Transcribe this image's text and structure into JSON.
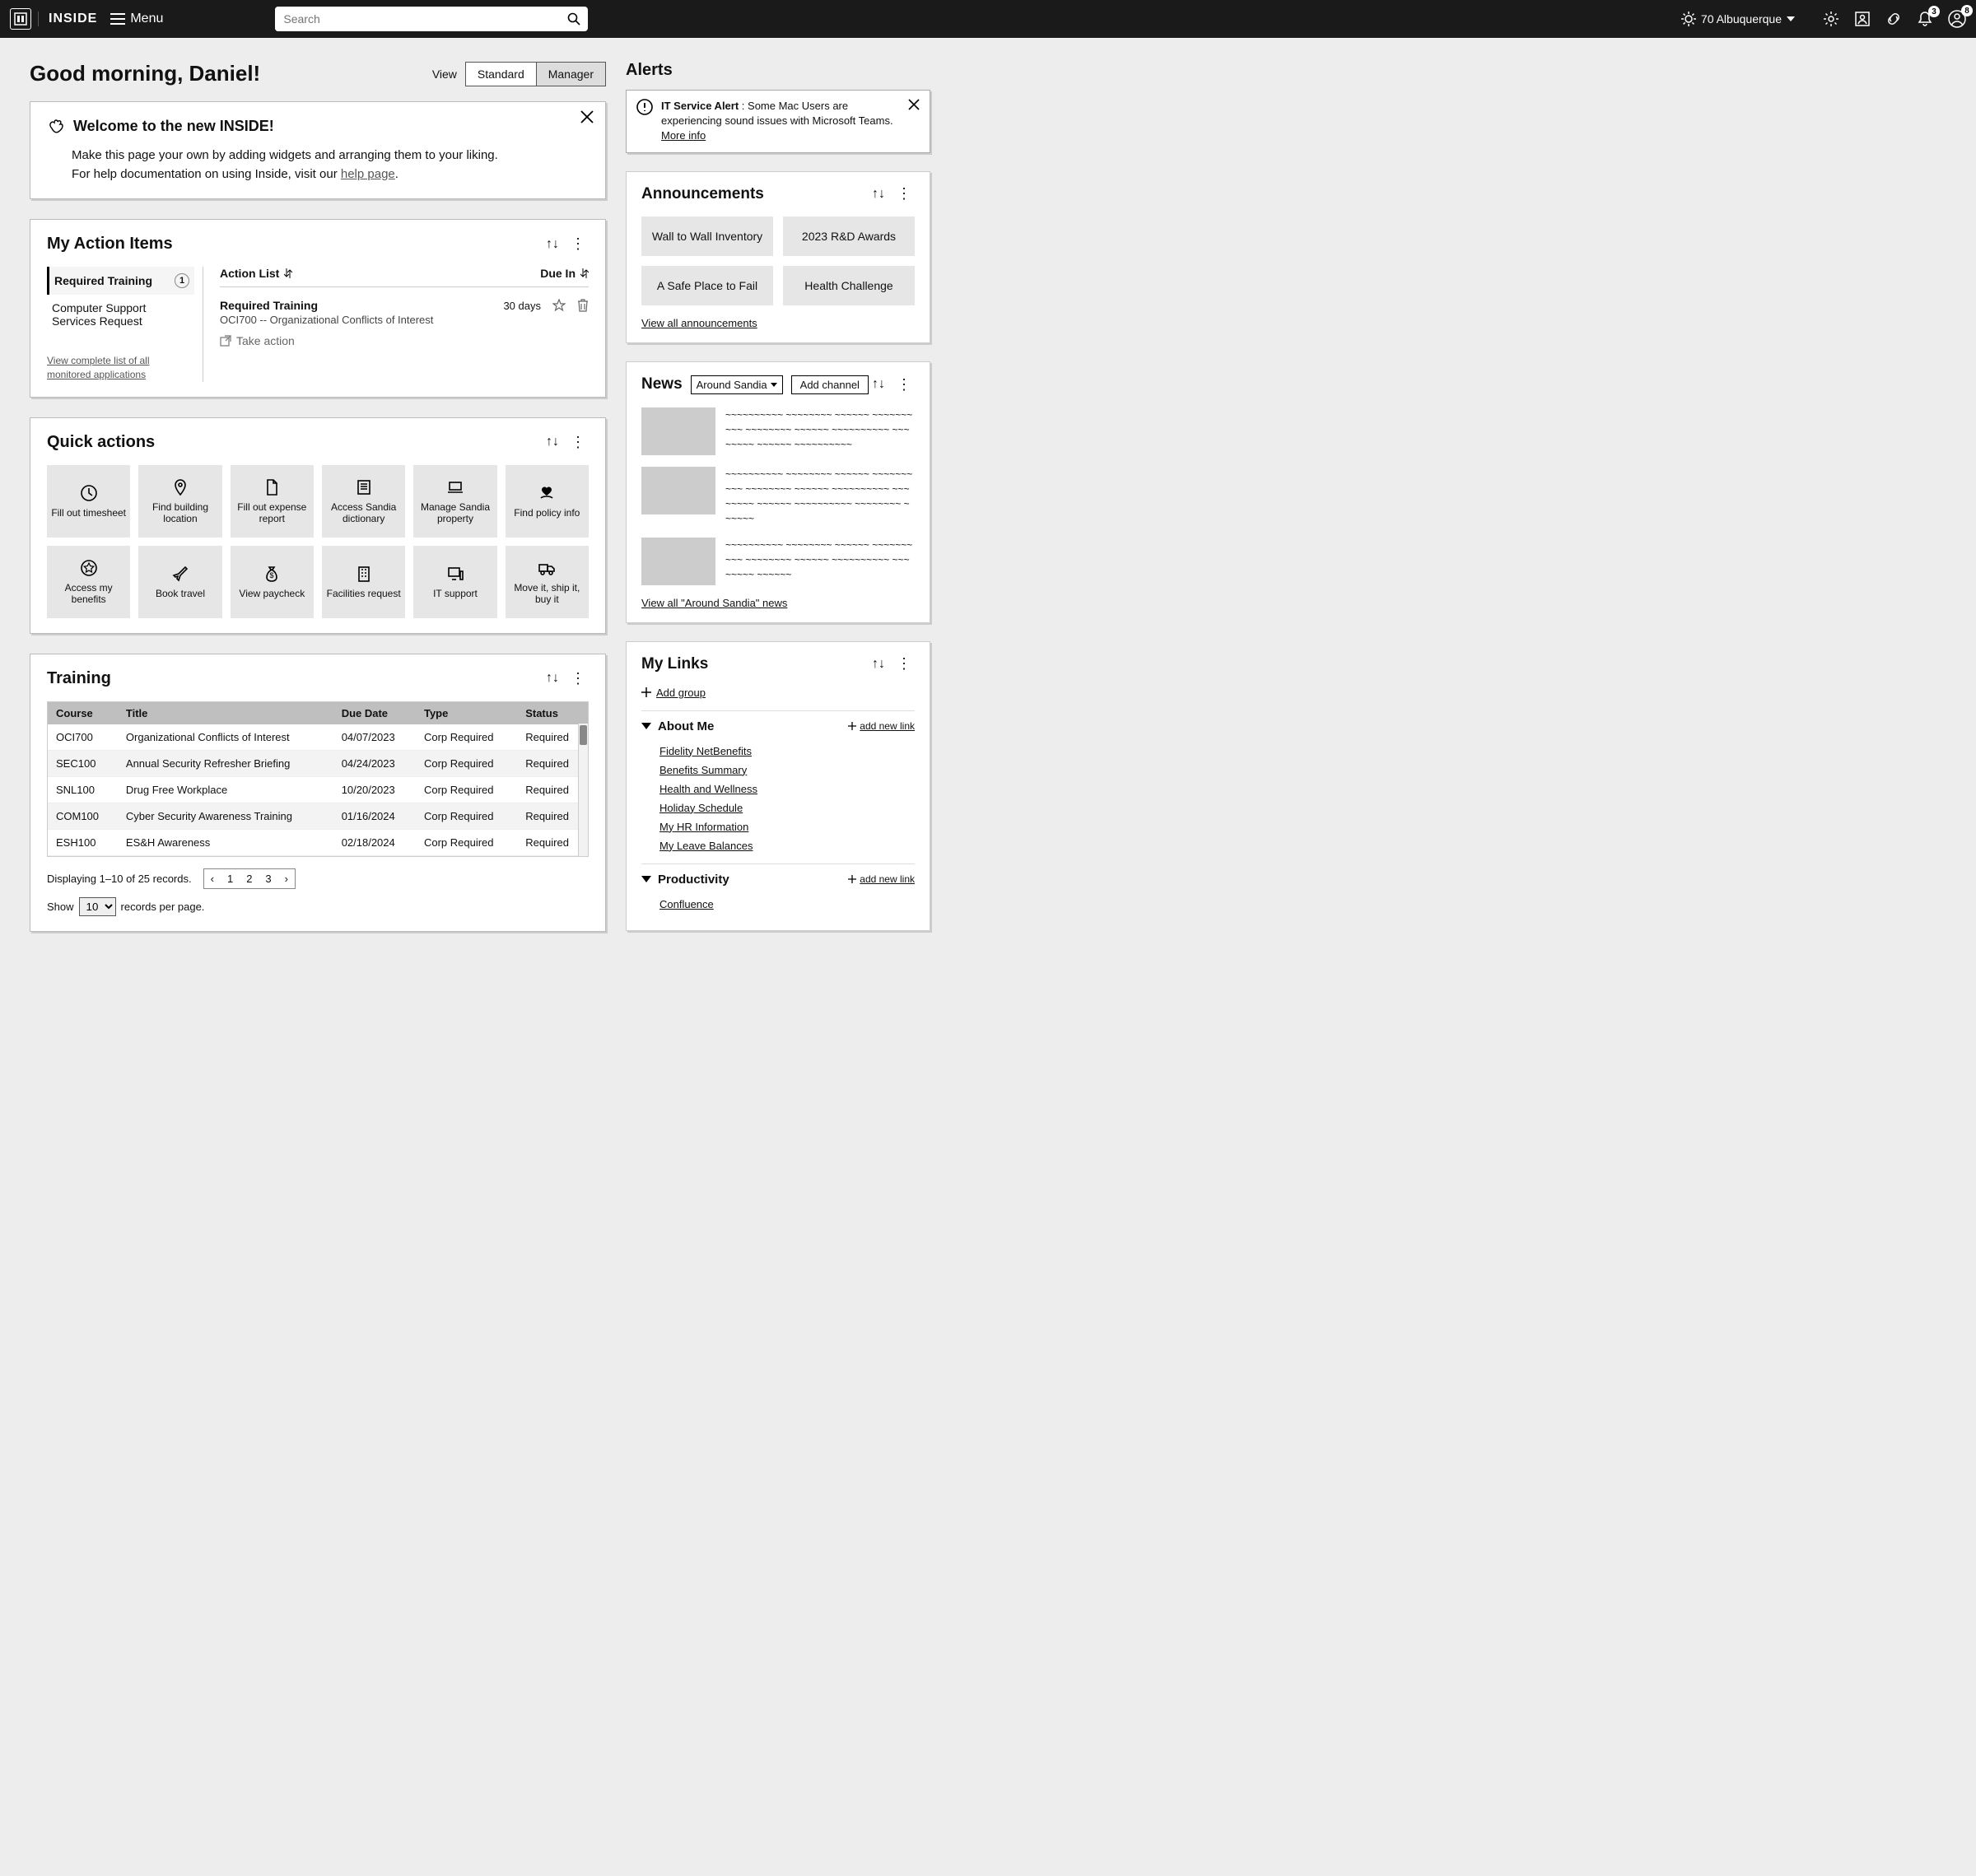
{
  "topbar": {
    "brand": "INSIDE",
    "menu_label": "Menu",
    "search_placeholder": "Search",
    "weather": "70 Albuquerque",
    "notif_count": "3",
    "account_count": "8"
  },
  "greeting": "Good morning, Daniel!",
  "view": {
    "label": "View",
    "standard": "Standard",
    "manager": "Manager"
  },
  "welcome": {
    "title": "Welcome to the new INSIDE!",
    "line1": "Make this page your own by adding widgets and arranging them to your liking.",
    "line2_a": "For help documentation on using Inside, visit our ",
    "line2_link": "help page",
    "line2_b": "."
  },
  "action_items": {
    "title": "My Action Items",
    "tabs": [
      {
        "label": "Required Training",
        "count": "1"
      },
      {
        "label": "Computer Support Services Request"
      }
    ],
    "view_all": "View complete list of all monitored applications",
    "col_action": "Action List",
    "col_due": "Due In",
    "row": {
      "title": "Required Training",
      "sub": "OCI700 -- Organizational Conflicts of Interest",
      "due": "30 days",
      "take_action": "Take action"
    }
  },
  "quick_actions": {
    "title": "Quick actions",
    "tiles": [
      "Fill out timesheet",
      "Find building location",
      "Fill out expense report",
      "Access Sandia dictionary",
      "Manage Sandia property",
      "Find policy info",
      "Access my benefits",
      "Book travel",
      "View paycheck",
      "Facilities request",
      "IT support",
      "Move it, ship it, buy it"
    ]
  },
  "training": {
    "title": "Training",
    "cols": [
      "Course",
      "Title",
      "Due Date",
      "Type",
      "Status"
    ],
    "rows": [
      [
        "OCI700",
        "Organizational Conflicts of Interest",
        "04/07/2023",
        "Corp Required",
        "Required"
      ],
      [
        "SEC100",
        "Annual Security Refresher Briefing",
        "04/24/2023",
        "Corp Required",
        "Required"
      ],
      [
        "SNL100",
        "Drug Free Workplace",
        "10/20/2023",
        "Corp Required",
        "Required"
      ],
      [
        "COM100",
        "Cyber Security Awareness Training",
        "01/16/2024",
        "Corp Required",
        "Required"
      ],
      [
        "ESH100",
        "ES&H Awareness",
        "02/18/2024",
        "Corp Required",
        "Required"
      ]
    ],
    "displaying": "Displaying 1–10 of 25 records.",
    "pages": [
      "1",
      "2",
      "3"
    ],
    "show_a": "Show",
    "show_val": "10",
    "show_b": "records per page."
  },
  "alerts": {
    "title": "Alerts",
    "item": {
      "strong": "IT Service Alert",
      "body": " : Some Mac Users are experiencing sound issues with Microsoft Teams. ",
      "more": "More info"
    }
  },
  "announcements": {
    "title": "Announcements",
    "tiles": [
      "Wall to Wall Inventory",
      "2023 R&D Awards",
      "A Safe Place to Fail",
      "Health Challenge"
    ],
    "view_all": "View all announcements"
  },
  "news": {
    "title": "News",
    "channel": "Around Sandia",
    "add_channel": "Add channel",
    "view_all": "View all \"Around Sandia\" news"
  },
  "mylinks": {
    "title": "My Links",
    "add_group": "Add group",
    "groups": [
      {
        "name": "About Me",
        "add": "add new link",
        "items": [
          "Fidelity NetBenefits",
          "Benefits Summary",
          "Health and Wellness",
          "Holiday Schedule",
          "My HR Information",
          "My Leave Balances"
        ]
      },
      {
        "name": "Productivity",
        "add": "add new link",
        "items": [
          "Confluence"
        ]
      }
    ]
  }
}
